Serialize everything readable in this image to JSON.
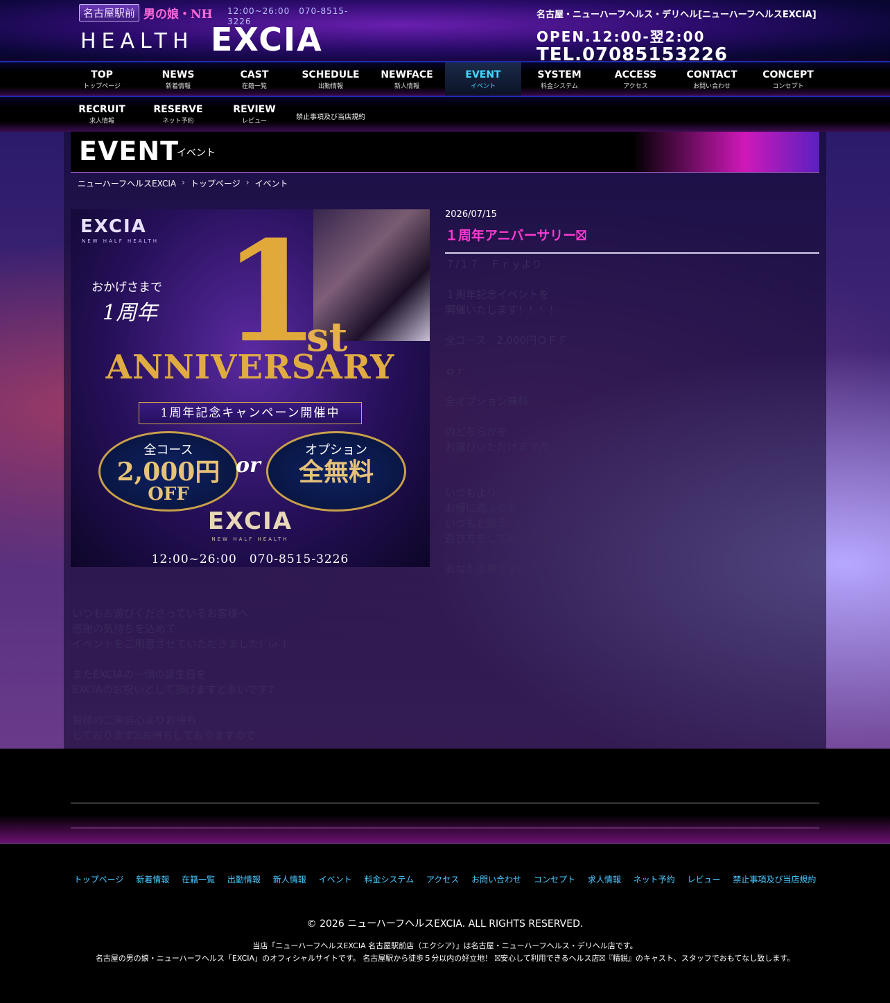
{
  "header": {
    "logo_location": "名古屋駅前",
    "logo_genre": "男の娘・NH",
    "logo_hours": "12:00~26:00　070-8515-3226",
    "logo_health": "HEALTH",
    "logo_brand": "EXCIA",
    "description": "名古屋・ニューハーフヘルス・デリヘル[ニューハーフヘルスEXCIA]",
    "open_hours": "OPEN.12:00-翌2:00",
    "tel": "TEL.07085153226"
  },
  "nav": {
    "row1": [
      {
        "en": "TOP",
        "jp": "トップページ"
      },
      {
        "en": "NEWS",
        "jp": "新着情報"
      },
      {
        "en": "CAST",
        "jp": "在籍一覧"
      },
      {
        "en": "SCHEDULE",
        "jp": "出勤情報"
      },
      {
        "en": "NEWFACE",
        "jp": "新人情報"
      },
      {
        "en": "EVENT",
        "jp": "イベント"
      },
      {
        "en": "SYSTEM",
        "jp": "料金システム"
      },
      {
        "en": "ACCESS",
        "jp": "アクセス"
      },
      {
        "en": "CONTACT",
        "jp": "お問い合わせ"
      },
      {
        "en": "CONCEPT",
        "jp": "コンセプト"
      }
    ],
    "row2": [
      {
        "en": "RECRUIT",
        "jp": "求人情報"
      },
      {
        "en": "RESERVE",
        "jp": "ネット予約"
      },
      {
        "en": "REVIEW",
        "jp": "レビュー"
      }
    ],
    "terms": "禁止事項及び当店規約",
    "active": "EVENT"
  },
  "page": {
    "title_en": "EVENT",
    "title_jp": "イベント",
    "breadcrumb": [
      "ニューハーフヘルスEXCIA",
      "トップページ",
      "イベント"
    ],
    "breadcrumb_sep": "›"
  },
  "banner": {
    "logo": "EXCIA",
    "logo_sub": "NEW HALF HEALTH",
    "thanks": "おかげさまで",
    "anniversary_jp": "1周年",
    "big_number": "1",
    "ordinal": "st",
    "anniversary_en": "ANNIVERSARY",
    "campaign": "1周年記念キャンペーン開催中",
    "left_top": "全コース",
    "left_mid": "2,000円",
    "left_bottom": "OFF",
    "or": "or",
    "right_top": "オプション",
    "right_mid": "全無料",
    "brand": "EXCIA",
    "brand_sub": "NEW HALF HEALTH",
    "footer": "12:00~26:00　070-8515-3226"
  },
  "post": {
    "date": "2026/07/15",
    "title": "１周年アニバーサリー⛝",
    "body": "７/１７　Ｆｒｙより\n\n１周年記念イベントを\n開催いたします！！！！\n\n全コース　2,000円ＯＦＦ\n\nｏｒ\n\n全オプション無料\n\nのどちらかを\nお選びいただけます♬\n\n\nいつもより\nお得に遊ぶのも\nいつもと違う\n遊び方をしてみるのも\n\nあなた次第です(￣∇￣)",
    "body_continued": "いつもお遊びくださっているお客様へ\n感謝の気持ちを込めて\nイベントをご用意させていただきました(´ω`)\n\nまたEXCIAの一個の誕生日を\nEXCIAのお祝いとして頂けますと幸いです♪\n\n皆様のご来店心よりお待ち\nしております⛝お待ちしておりますので"
  },
  "footer": {
    "links": [
      "トップページ",
      "新着情報",
      "在籍一覧",
      "出勤情報",
      "新人情報",
      "イベント",
      "料金システム",
      "アクセス",
      "お問い合わせ",
      "コンセプト",
      "求人情報",
      "ネット予約",
      "レビュー",
      "禁止事項及び当店規約"
    ],
    "copyright": "© 2026 ニューハーフヘルスEXCIA. ALL RIGHTS RESERVED.",
    "desc_line1": "当店「ニューハーフヘルスEXCIA 名古屋駅前店（エクシア）」は名古屋・ニューハーフヘルス・デリヘル店です。",
    "desc_line2": "名古屋の男の娘・ニューハーフヘルス「EXCIA」のオフィシャルサイトです。 名古屋駅から徒歩５分以内の好立地！ ⛝安心して利用できるヘルス店⛝『精鋭』のキャスト、スタッフでおもてなし致します。"
  },
  "colors": {
    "accent_pink": "#ff3ad2",
    "active_nav": "#3fd9ff",
    "footer_link": "#4ac8ff"
  }
}
